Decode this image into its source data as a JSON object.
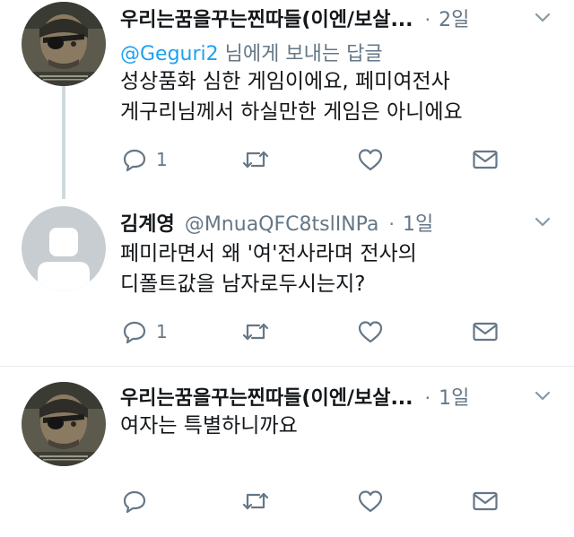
{
  "tweets": [
    {
      "name": "우리는꿈을꾸는찐따들(이엔/보살...",
      "time": "2일",
      "reply_prefix": "@Geguri2",
      "reply_suffix": " 님에게 보내는 답글",
      "lines": [
        "성상품화 심한 게임이에요, 페미여전사",
        "게구리님께서 하실만한 게임은 아니에요"
      ],
      "reply_count": "1",
      "avatar": "snake-avatar"
    },
    {
      "name": "김계영",
      "handle": "@MnuaQFC8tslINPa",
      "time": "1일",
      "lines": [
        "페미라면서 왜 '여'전사라며 전사의",
        "디폴트값을 남자로두시는지?"
      ],
      "reply_count": "1",
      "avatar": "default-avatar"
    },
    {
      "name": "우리는꿈을꾸는찐따들(이엔/보살...",
      "time": "1일",
      "lines": [
        "여자는 특별하니까요"
      ],
      "reply_count": "",
      "avatar": "snake-avatar"
    }
  ],
  "separator": "·",
  "colors": {
    "text": "#14171a",
    "secondary": "#657786",
    "accent": "#1da1f2",
    "line": "#cfd9de"
  }
}
